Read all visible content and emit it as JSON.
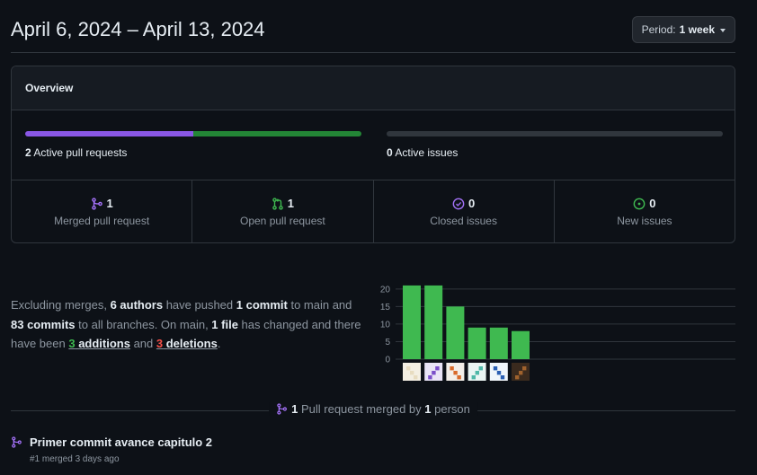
{
  "header": {
    "date_range": "April 6, 2024 – April 13, 2024",
    "period_label": "Period:",
    "period_value": "1 week"
  },
  "overview": {
    "title": "Overview",
    "pull_requests": {
      "count": "2",
      "label": "Active pull requests",
      "merged_fraction": 0.5,
      "open_fraction": 0.5
    },
    "issues": {
      "count": "0",
      "label": "Active issues"
    },
    "stats": [
      {
        "icon": "git-merge-icon",
        "count": "1",
        "label": "Merged pull request",
        "color": "#a371f7"
      },
      {
        "icon": "git-pull-request-icon",
        "count": "1",
        "label": "Open pull request",
        "color": "#3fb950"
      },
      {
        "icon": "issue-closed-icon",
        "count": "0",
        "label": "Closed issues",
        "color": "#a371f7"
      },
      {
        "icon": "issue-opened-icon",
        "count": "0",
        "label": "New issues",
        "color": "#3fb950"
      }
    ]
  },
  "summary": {
    "t1": "Excluding merges, ",
    "authors": "6 authors",
    "t2": " have pushed ",
    "commits_main": "1 commit",
    "t3": " to main and ",
    "commits_all": "83 commits",
    "t4": " to all branches. On main, ",
    "files": "1 file",
    "t5": " has changed and there have been ",
    "additions_num": "3",
    "additions_word": " additions",
    "t6": " and ",
    "deletions_num": "3",
    "deletions_word": " deletions",
    "t7": "."
  },
  "chart_data": {
    "type": "bar",
    "categories": [
      "author-1",
      "author-2",
      "author-3",
      "author-4",
      "author-5",
      "author-6"
    ],
    "values": [
      21,
      21,
      15,
      9,
      9,
      8
    ],
    "yticks": [
      0,
      5,
      10,
      15,
      20
    ],
    "ylim": [
      0,
      22
    ],
    "bar_color": "#3fb950",
    "grid": true
  },
  "merged": {
    "count": "1",
    "text1": " Pull request merged by ",
    "people": "1",
    "text2": " person"
  },
  "pr": {
    "title": "Primer commit avance capitulo 2",
    "meta": "#1 merged 3 days ago"
  }
}
